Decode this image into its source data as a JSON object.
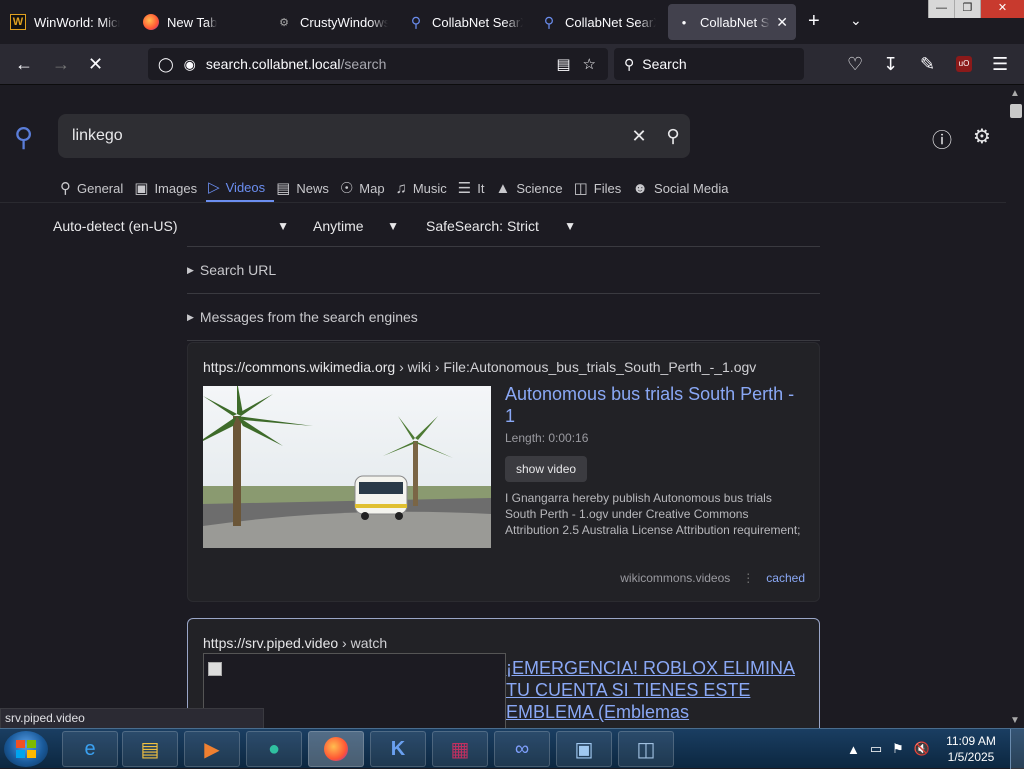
{
  "browser": {
    "tabs": [
      {
        "label": "WinWorld: Micro",
        "icon": "W"
      },
      {
        "label": "New Tab",
        "icon": "firefox"
      },
      {
        "label": "CrustyWindows",
        "icon": "crusty"
      },
      {
        "label": "CollabNet SearX",
        "icon": "search"
      },
      {
        "label": "CollabNet SearX",
        "icon": "search"
      },
      {
        "label": "CollabNet Sea",
        "icon": "dot"
      }
    ],
    "url_host": "search.collabnet.local",
    "url_path": "/search",
    "search_placeholder": "Search"
  },
  "page": {
    "query": "linkego",
    "categories": [
      "General",
      "Images",
      "Videos",
      "News",
      "Map",
      "Music",
      "It",
      "Science",
      "Files",
      "Social Media"
    ],
    "active_category": "Videos",
    "filters": {
      "language": "Auto-detect (en-US)",
      "time": "Anytime",
      "safesearch": "SafeSearch: Strict"
    },
    "disclosures": [
      "Search URL",
      "Messages from the search engines"
    ],
    "results": [
      {
        "url": "https://commons.wikimedia.org",
        "breadcrumb": "› wiki › File:Autonomous_bus_trials_South_Perth_-_1.ogv",
        "title": "Autonomous bus trials South Perth - 1",
        "length": "Length: 0:00:16",
        "button": "show video",
        "description": "I Gnangarra hereby publish Autonomous bus trials South Perth - 1.ogv under Creative Commons Attribution 2.5 Australia License Attribution requirement;",
        "engine": "wikicommons.videos",
        "cached": "cached"
      },
      {
        "url": "https://srv.piped.video",
        "breadcrumb": "› watch",
        "title": "¡EMERGENCIA! ROBLOX ELIMINA TU CUENTA SI TIENES ESTE EMBLEMA (Emblemas"
      }
    ]
  },
  "status_tooltip": "srv.piped.video",
  "taskbar": {
    "time": "11:09 AM",
    "date": "1/5/2025"
  },
  "colors": {
    "accent": "#6b8ef0",
    "link": "#8aa8f5",
    "background": "#1c1b22"
  }
}
